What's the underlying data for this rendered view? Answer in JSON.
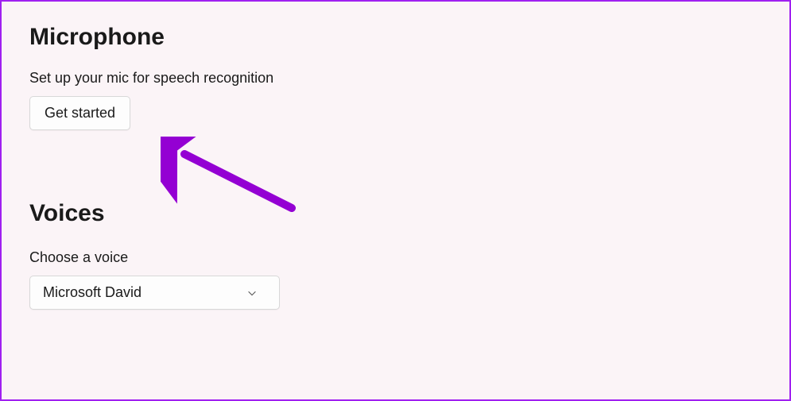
{
  "microphone": {
    "heading": "Microphone",
    "description": "Set up your mic for speech recognition",
    "button_label": "Get started"
  },
  "voices": {
    "heading": "Voices",
    "choose_label": "Choose a voice",
    "selected_voice": "Microsoft David"
  },
  "colors": {
    "border": "#a020f0",
    "background": "#fbf4f7",
    "arrow": "#9400d3"
  }
}
